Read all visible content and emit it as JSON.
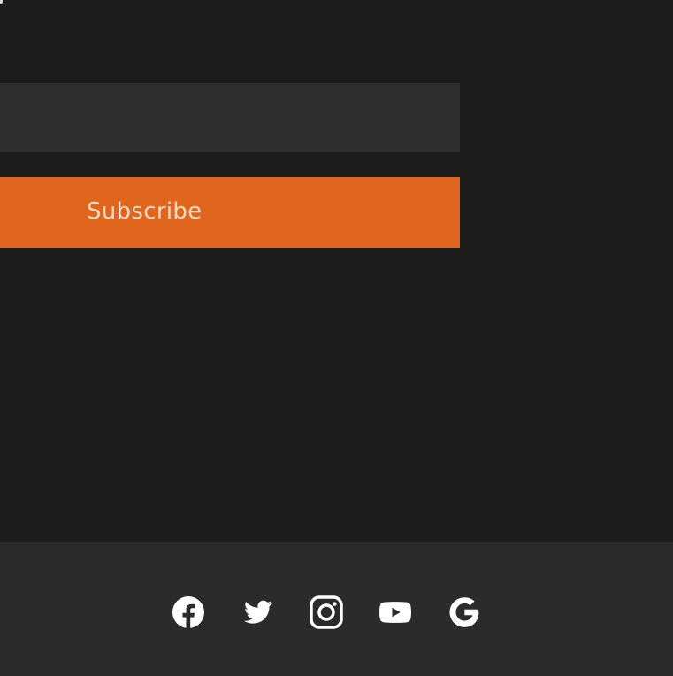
{
  "newsletter": {
    "email_input": {
      "value": "",
      "placeholder": ""
    },
    "subscribe_label": "Subscribe"
  },
  "footer": {
    "social_links": [
      {
        "icon": "facebook-icon"
      },
      {
        "icon": "twitter-icon"
      },
      {
        "icon": "instagram-icon"
      },
      {
        "icon": "youtube-icon"
      },
      {
        "icon": "google-icon"
      }
    ]
  },
  "colors": {
    "page_background": "#1d1d1d",
    "input_background": "#2d2d2d",
    "accent": "#e0661e",
    "button_text": "#f8d9c6",
    "footer_background": "#2b2b2b",
    "icon": "#ffffff"
  }
}
